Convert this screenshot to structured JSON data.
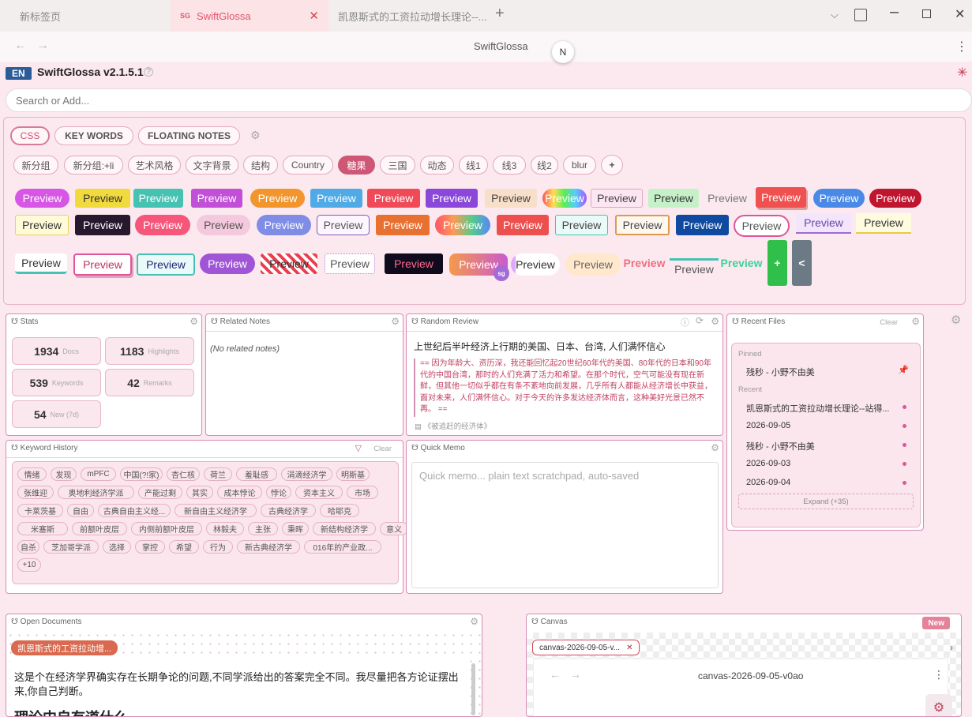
{
  "browser": {
    "tabs": [
      {
        "label": "新标签页"
      },
      {
        "label": "SwiftGlossa",
        "favicon": "SG"
      },
      {
        "label": "凯恩斯式的工资拉动增长理论--..."
      }
    ],
    "address_title": "SwiftGlossa",
    "n_badge": "N"
  },
  "app": {
    "lang": "EN",
    "title": "SwiftGlossa v2.1.5.1",
    "search_placeholder": "Search or Add..."
  },
  "css_panel": {
    "top_tabs": [
      "CSS",
      "KEY WORDS",
      "FLOATING NOTES"
    ],
    "groups": [
      "新分组",
      "新分组:+li",
      "艺术风格",
      "文字背景",
      "结构",
      "Country",
      "糖果",
      "三国",
      "动态",
      "线1",
      "线3",
      "线2",
      "blur",
      "+"
    ],
    "active_group": "糖果",
    "preview_label": "Preview",
    "add_label": "+",
    "collapse_label": "<"
  },
  "stats": {
    "title": "Stats",
    "items": [
      {
        "value": "1934",
        "label": "Docs"
      },
      {
        "value": "1183",
        "label": "Highlights"
      },
      {
        "value": "539",
        "label": "Keywords"
      },
      {
        "value": "42",
        "label": "Remarks"
      },
      {
        "value": "54",
        "label": "New (7d)"
      }
    ]
  },
  "related_notes": {
    "title": "Related Notes",
    "empty": "(No related notes)"
  },
  "random_review": {
    "title": "Random Review",
    "heading": "上世纪后半叶经济上行期的美国、日本、台湾, 人们满怀信心",
    "quote": "== 因为年龄大、资历深，我还能回忆起20世纪60年代的美国、80年代的日本和90年代的中国台湾，那时的人们充满了活力和希望。在那个时代，空气可能没有现在新鲜，但其他一切似乎都在有条不紊地向前发展，几乎所有人都能从经济增长中获益，面对未来，人们满怀信心。对于今天的许多发达经济体而言，这种美好光景已然不再。 ==",
    "source": "《被追赶的经济体》"
  },
  "recent_files": {
    "title": "Recent Files",
    "clear": "Clear",
    "pinned_label": "Pinned",
    "pinned": [
      "残秒 - 小野不由美"
    ],
    "recent_label": "Recent",
    "recent": [
      "凯恩斯式的工资拉动增长理论--站得...",
      "2026-09-05",
      "残秒 - 小野不由美",
      "2026-09-03",
      "2026-09-04"
    ],
    "expand": "Expand (+35)"
  },
  "keyword_history": {
    "title": "Keyword History",
    "clear": "Clear",
    "keywords": [
      "情绪",
      "发现",
      "mPFC",
      "中国(?!家)",
      "杏仁核",
      "荷兰",
      "羞耻感",
      "涓滴经济学",
      "明斯基",
      "张维迎",
      "奥地利经济学派",
      "产能过剩",
      "其实",
      "成本悖论",
      "悖论",
      "资本主义",
      "市场",
      "卡莱茨基",
      "自由",
      "古典自由主义经...",
      "新自由主义经济学",
      "古典经济学",
      "哈耶克",
      "米塞斯",
      "前额叶皮层",
      "内侧前额叶皮层",
      "林毅夫",
      "主张",
      "秉晖",
      "新结构经济学",
      "意义",
      "自杀",
      "芝加哥学派",
      "选择",
      "掌控",
      "希望",
      "行为",
      "新古典经济学",
      "016年的产业政..."
    ],
    "more": "+10"
  },
  "quick_memo": {
    "title": "Quick Memo",
    "placeholder": "Quick memo... plain text scratchpad, auto-saved"
  },
  "open_documents": {
    "title": "Open Documents",
    "doc_tab": "凯恩斯式的工资拉动增...",
    "text": "这是个在经济学界确实存在长期争论的问题,不同学派给出的答案完全不同。我尽量把各方论证摆出来,你自己判断。",
    "heading": "理论中自有道什么"
  },
  "canvas": {
    "title": "Canvas",
    "new_label": "New",
    "tab": "canvas-2026-09-05-v...",
    "name": "canvas-2026-09-05-v0ao"
  }
}
